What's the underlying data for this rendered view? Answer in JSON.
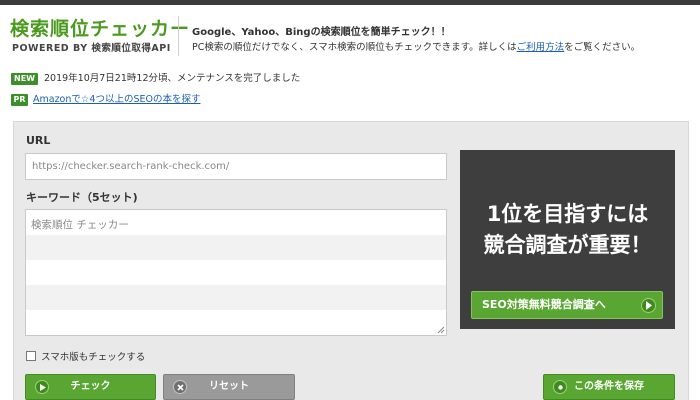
{
  "header": {
    "logo_title": "検索順位チェッカー",
    "logo_sub": "POWERED BY 検索順位取得API",
    "intro_title": "Google、Yahoo、Bingの検索順位を簡単チェック！！",
    "intro_text_before": "PC検索の順位だけでなく、スマホ検索の順位もチェックできます。詳しくは",
    "intro_link": "ご利用方法",
    "intro_text_after": "をご覧ください。"
  },
  "news": {
    "badge": "NEW",
    "text": "2019年10月7日21時12分頃、メンテナンスを完了しました"
  },
  "pr": {
    "badge": "PR",
    "link": "Amazonで☆4つ以上のSEOの本を探す"
  },
  "form": {
    "url_label": "URL",
    "url_placeholder": "https://checker.search-rank-check.com/",
    "keyword_label": "キーワード（5セット)",
    "keyword_placeholder": "検索順位 チェッカー",
    "smartphone_label": "スマホ版もチェックする",
    "smartphone_checked": false
  },
  "ad": {
    "line1": "1位を目指すには",
    "line2": "競合調査が重要！",
    "button": "SEO対策無料競合調査へ"
  },
  "buttons": {
    "check": "チェック",
    "reset": "リセット",
    "save": "この条件を保存"
  },
  "colors": {
    "brand_green": "#4a9a1f",
    "button_green": "#5aa632",
    "ad_background": "#3e3e3e",
    "link_blue": "#1a5fb4"
  },
  "icons": {
    "check_button": "arrow-circle-icon",
    "reset_button": "close-circle-icon",
    "save_button": "save-circle-icon",
    "ad_button": "chevron-right-circle-icon"
  }
}
